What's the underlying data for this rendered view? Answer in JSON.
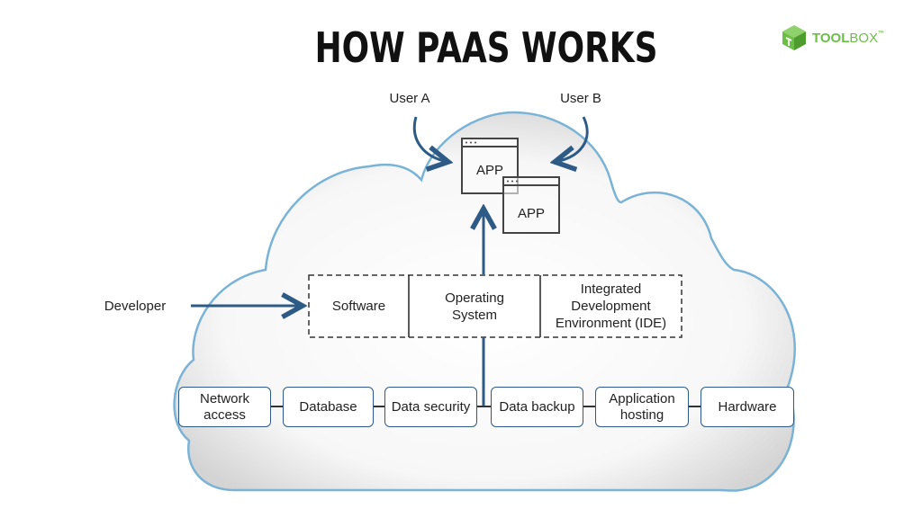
{
  "title": "HOW PAAS WORKS",
  "logo": {
    "bold": "TOOL",
    "light": "BOX",
    "tm": "™",
    "color": "#6cbf45"
  },
  "users": {
    "a": "User A",
    "b": "User B"
  },
  "apps": [
    "APP",
    "APP"
  ],
  "developer": "Developer",
  "platform_layer": {
    "software": "Software",
    "os_line1": "Operating",
    "os_line2": "System",
    "ide_line1": "Integrated",
    "ide_line2": "Development",
    "ide_line3": "Environment (IDE)"
  },
  "infrastructure": [
    {
      "l1": "Network",
      "l2": "access"
    },
    {
      "l1": "Database",
      "l2": ""
    },
    {
      "l1": "Data security",
      "l2": ""
    },
    {
      "l1": "Data backup",
      "l2": ""
    },
    {
      "l1": "Application",
      "l2": "hosting"
    },
    {
      "l1": "Hardware",
      "l2": ""
    }
  ],
  "colors": {
    "arrow": "#2d5b85",
    "cloud_stroke": "#7ab3d6",
    "box_border": "#2d5b85"
  }
}
